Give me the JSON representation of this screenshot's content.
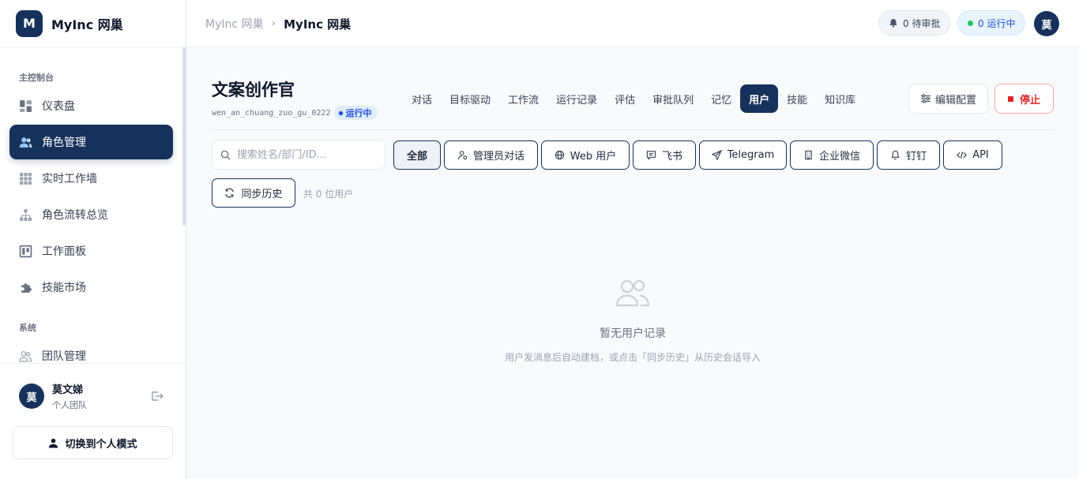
{
  "brand": {
    "logo_letter": "M",
    "name": "MyInc 网巢"
  },
  "sidebar": {
    "section_main": "主控制台",
    "items": [
      {
        "label": "仪表盘",
        "icon": "dashboard-icon"
      },
      {
        "label": "角色管理",
        "icon": "users-icon",
        "active": true
      },
      {
        "label": "实时工作墙",
        "icon": "grid-icon"
      },
      {
        "label": "角色流转总览",
        "icon": "hierarchy-icon"
      },
      {
        "label": "工作面板",
        "icon": "kanban-icon"
      },
      {
        "label": "技能市场",
        "icon": "puzzle-icon"
      }
    ],
    "section_system": "系统",
    "system_items": [
      {
        "label": "团队管理",
        "icon": "team-icon"
      }
    ],
    "user": {
      "avatar": "莫",
      "name": "莫文娣",
      "team": "个人团队"
    },
    "switch_label": "切换到个人模式"
  },
  "topbar": {
    "breadcrumb": [
      "MyInc 网巢",
      "MyInc 网巢"
    ],
    "pending_label": "0 待审批",
    "running_label": "0 运行中",
    "avatar": "莫"
  },
  "role": {
    "title": "文案创作官",
    "id": "wen_an_chuang_zuo_gu_0222",
    "status": "运行中"
  },
  "tabs": [
    "对话",
    "目标驱动",
    "工作流",
    "运行记录",
    "评估",
    "审批队列",
    "记忆",
    "用户",
    "技能",
    "知识库"
  ],
  "active_tab": "用户",
  "actions": {
    "edit_label": "编辑配置",
    "stop_label": "停止"
  },
  "users_panel": {
    "search_placeholder": "搜索姓名/部门/ID...",
    "filters": [
      "全部",
      "管理员对话",
      "Web 用户",
      "飞书",
      "Telegram",
      "企业微信",
      "钉钉",
      "API"
    ],
    "sync_label": "同步历史",
    "count_label": "共 0 位用户",
    "empty_title": "暂无用户记录",
    "empty_desc": "用户发消息后自动建档，或点击「同步历史」从历史会话导入"
  },
  "colors": {
    "primary": "#16325c",
    "danger": "#dc2626",
    "running": "#22c55e"
  }
}
